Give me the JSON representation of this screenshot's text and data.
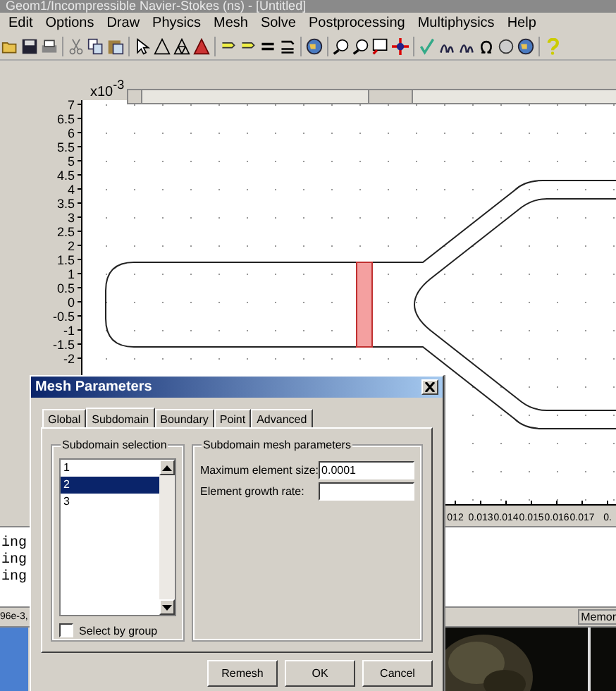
{
  "window": {
    "title": "Geom1/Incompressible Navier-Stokes (ns) - [Untitled]"
  },
  "menu": [
    "Edit",
    "Options",
    "Draw",
    "Physics",
    "Mesh",
    "Solve",
    "Postprocessing",
    "Multiphysics",
    "Help"
  ],
  "plot": {
    "exponent_base": "x10",
    "exponent": "-3",
    "y_ticks": [
      "7",
      "6.5",
      "6",
      "5.5",
      "5",
      "4.5",
      "4",
      "3.5",
      "3",
      "2.5",
      "2",
      "1.5",
      "1",
      "0.5",
      "0",
      "-0.5",
      "-1",
      "-1.5",
      "-2"
    ],
    "x_ticks": [
      "012",
      "0.013",
      "0.014",
      "0.015",
      "0.016",
      "0.017",
      "0."
    ]
  },
  "console": {
    "lines": [
      "ing",
      "ing",
      "ing"
    ]
  },
  "status_bar": {
    "coordinates": "96e-3,",
    "memory": "Memor"
  },
  "dialog": {
    "title": "Mesh Parameters",
    "tabs": [
      {
        "label": "Global",
        "selected": false
      },
      {
        "label": "Subdomain",
        "selected": true
      },
      {
        "label": "Boundary",
        "selected": false
      },
      {
        "label": "Point",
        "selected": false
      },
      {
        "label": "Advanced",
        "selected": false
      }
    ],
    "selection_group": {
      "title": "Subdomain selection",
      "items": [
        {
          "label": "1",
          "selected": false
        },
        {
          "label": "2",
          "selected": true
        },
        {
          "label": "3",
          "selected": false
        }
      ],
      "select_by_group": {
        "label": "Select by group",
        "checked": false
      }
    },
    "parameters_group": {
      "title": "Subdomain mesh parameters",
      "fields": [
        {
          "label": "Maximum element size:",
          "value": "0.0001"
        },
        {
          "label": "Element growth rate:"
        }
      ]
    },
    "buttons": [
      "Remesh",
      "OK",
      "Cancel"
    ]
  }
}
